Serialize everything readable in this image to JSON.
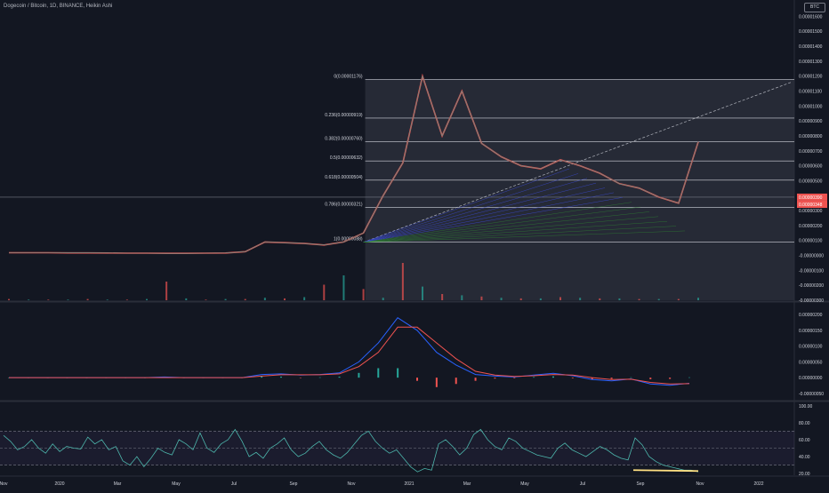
{
  "header": {
    "title": "Dogecoin / Bitcoin, 1D, BINANCE, Heikin Ashi",
    "currency": "BTC"
  },
  "chart_data": [
    {
      "type": "line",
      "title": "Dogecoin / Bitcoin, 1D, BINANCE, Heikin Ashi",
      "y_ticks": [
        "0.00001600",
        "0.00001500",
        "0.00001400",
        "0.00001300",
        "0.00001200",
        "0.00001100",
        "0.00001000",
        "0.00000900",
        "0.00000800",
        "0.00000700",
        "0.00000600",
        "0.00000500",
        "0.00000400",
        "0.00000300",
        "0.00000200",
        "0.00000100",
        "-0.00000000",
        "-0.00000100",
        "-0.00000200",
        "-0.00000300"
      ],
      "ylim": [
        -3e-06,
        1.65e-05
      ],
      "fib_levels": [
        {
          "label": "0(0.00001176)",
          "value": 1.176e-05
        },
        {
          "label": "0.236(0.00000919)",
          "value": 9.19e-06
        },
        {
          "label": "0.382(0.00000760)",
          "value": 7.6e-06
        },
        {
          "label": "0.5(0.00000632)",
          "value": 6.32e-06
        },
        {
          "label": "0.618(0.00000504)",
          "value": 5.04e-06
        },
        {
          "label": "0.786(0.00000321)",
          "value": 3.21e-06
        },
        {
          "label": "1(0.00000088)",
          "value": 8.8e-07
        }
      ],
      "price_badges": [
        "0.00000390",
        "0.00000348"
      ],
      "series": [
        {
          "values": [
            1.8e-07,
            1.8e-07,
            1.8e-07,
            1.7e-07,
            1.7e-07,
            1.6e-07,
            1.5e-07,
            1.5e-07,
            1.4e-07,
            1.4e-07,
            1.5e-07,
            1.6e-07,
            2.5e-07,
            9e-07,
            8.5e-07,
            8e-07,
            7e-07,
            9e-07,
            1.5e-06,
            4e-06,
            6.2e-06,
            1.2e-05,
            8e-06,
            1.1e-05,
            7.5e-06,
            6.6e-06,
            6e-06,
            5.8e-06,
            6.4e-06,
            6e-06,
            5.5e-06,
            4.8e-06,
            4.5e-06,
            3.9e-06,
            3.5e-06,
            7.6e-06
          ]
        }
      ],
      "x": [
        "2019-11",
        "2019-12",
        "2020-01",
        "2020-02",
        "2020-03",
        "2020-04",
        "2020-05",
        "2020-06",
        "2020-07",
        "2020-08",
        "2020-09",
        "2020-10",
        "2020-11",
        "2020-12",
        "2021-01",
        "2021-01b",
        "2021-02",
        "2021-03",
        "2021-04",
        "2021-04b",
        "2021-05",
        "2021-05b",
        "2021-05c",
        "2021-05d",
        "2021-06",
        "2021-06b",
        "2021-07",
        "2021-07b",
        "2021-08",
        "2021-08b",
        "2021-09",
        "2021-09b",
        "2021-10",
        "2021-10b",
        "2021-10c",
        "2021-10d"
      ]
    },
    {
      "type": "line",
      "title": "",
      "y_ticks": [
        "0.00000200",
        "0.00000150",
        "0.00000100",
        "0.00000050",
        "0.00000000",
        "-0.00000050"
      ],
      "ylim": [
        -7e-07,
        2.2e-06
      ],
      "series": [
        {
          "values": [
            0,
            0,
            0,
            0,
            0,
            0,
            0,
            0,
            2e-08,
            0,
            0,
            0,
            0,
            1e-07,
            1.2e-07,
            8e-08,
            1e-07,
            1.5e-07,
            5e-07,
            1.1e-06,
            1.9e-06,
            1.5e-06,
            8e-07,
            4e-07,
            1e-07,
            5e-08,
            2e-08,
            8e-08,
            1.4e-07,
            6e-08,
            -6e-08,
            -1e-07,
            -4e-08,
            -2e-07,
            -2.4e-07,
            -1.8e-07
          ]
        },
        {
          "values": [
            0,
            0,
            0,
            0,
            0,
            0,
            0,
            0,
            0,
            0,
            0,
            0,
            0,
            5e-08,
            9e-08,
            9e-08,
            9e-08,
            1.2e-07,
            3.5e-07,
            8e-07,
            1.6e-06,
            1.6e-06,
            1.1e-06,
            6e-07,
            2e-07,
            8e-08,
            4e-08,
            6e-08,
            1e-07,
            8e-08,
            0,
            -6e-08,
            -5e-08,
            -1.5e-07,
            -2e-07,
            -1.9e-07
          ]
        }
      ]
    },
    {
      "type": "line",
      "title": "",
      "y_ticks": [
        "100.00",
        "80.00",
        "60.00",
        "40.00",
        "20.00"
      ],
      "ylim": [
        18,
        104
      ],
      "bands": [
        70,
        50,
        30
      ],
      "series": [
        {
          "values": [
            65,
            58,
            48,
            52,
            60,
            50,
            44,
            55,
            46,
            52,
            50,
            49,
            63,
            55,
            60,
            48,
            52,
            35,
            30,
            40,
            28,
            38,
            50,
            45,
            42,
            60,
            55,
            48,
            68,
            50,
            45,
            55,
            60,
            72,
            58,
            40,
            45,
            38,
            50,
            55,
            62,
            48,
            40,
            44,
            52,
            58,
            48,
            42,
            38,
            45,
            55,
            65,
            70,
            58,
            50,
            44,
            48,
            38,
            28,
            22,
            26,
            24,
            55,
            60,
            52,
            42,
            50,
            66,
            72,
            60,
            52,
            48,
            62,
            58,
            50,
            46,
            42,
            40,
            38,
            50,
            56,
            48,
            44,
            40,
            46,
            52,
            48,
            42,
            38,
            36,
            62,
            54,
            40,
            34,
            30,
            28,
            26,
            24,
            24,
            22
          ]
        }
      ]
    }
  ],
  "x_axis": {
    "ticks": [
      "Nov",
      "2020",
      "Mar",
      "May",
      "Jul",
      "Sep",
      "Nov",
      "2021",
      "Mar",
      "May",
      "Jul",
      "Sep",
      "Nov",
      "2022"
    ]
  }
}
